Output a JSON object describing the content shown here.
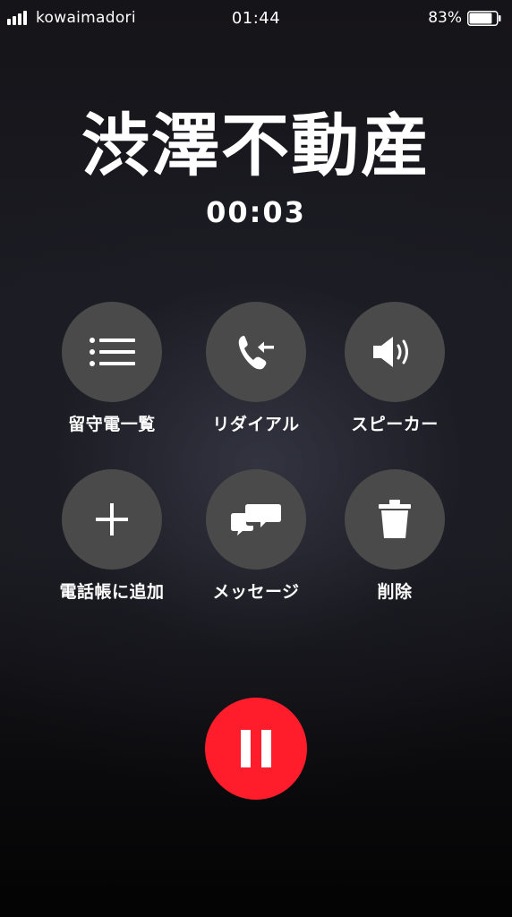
{
  "status_bar": {
    "carrier": "kowaimadori",
    "time": "01:44",
    "battery_percent": "83%",
    "battery_level": 0.83,
    "signal_icon": "signal-bars-icon",
    "battery_icon": "battery-icon"
  },
  "call": {
    "caller_name": "渋澤不動産",
    "duration": "00:03"
  },
  "actions": [
    {
      "label": "留守電一覧",
      "icon": "voicemail-list-icon"
    },
    {
      "label": "リダイアル",
      "icon": "redial-icon"
    },
    {
      "label": "スピーカー",
      "icon": "speaker-icon"
    },
    {
      "label": "電話帳に追加",
      "icon": "plus-icon"
    },
    {
      "label": "メッセージ",
      "icon": "message-bubbles-icon"
    },
    {
      "label": "削除",
      "icon": "trash-icon"
    }
  ],
  "pause": {
    "icon": "pause-icon",
    "color": "#ff1d2b"
  },
  "colors": {
    "button_bg": "#4a4a4a",
    "text": "#ffffff",
    "accent_red": "#ff1d2b"
  }
}
